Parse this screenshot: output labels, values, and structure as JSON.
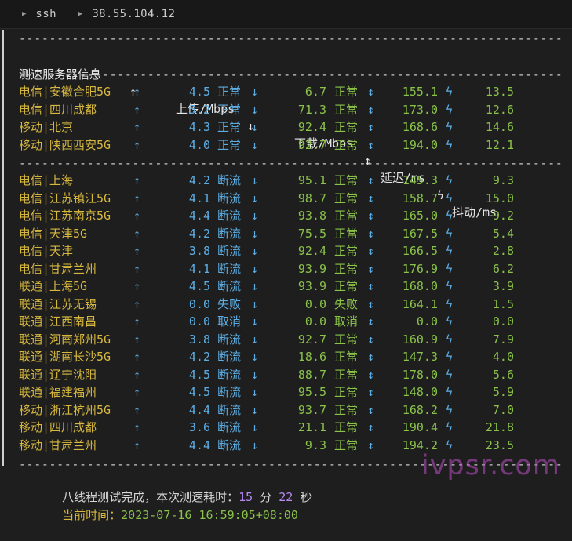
{
  "breadcrumb": {
    "items": [
      "ssh",
      "38.55.104.12"
    ]
  },
  "table": {
    "divider": "------------------------------------------------------------------------",
    "headers": [
      "测速服务器信息",
      "↑",
      "上传/Mbps",
      "↓",
      "下载/Mbps",
      "↕",
      "延迟/ms",
      "ϟ",
      "抖动/ms"
    ],
    "group1": [
      {
        "server": "电信|安徽合肥5G",
        "up": "4.5",
        "up_status": "正常",
        "down": "6.7",
        "down_status": "正常",
        "latency": "155.1",
        "jitter": "13.5"
      },
      {
        "server": "电信|四川成都",
        "up": "5.2",
        "up_status": "正常",
        "down": "71.3",
        "down_status": "正常",
        "latency": "173.0",
        "jitter": "12.6"
      },
      {
        "server": "移动|北京",
        "up": "4.3",
        "up_status": "正常",
        "down": "92.4",
        "down_status": "正常",
        "latency": "168.6",
        "jitter": "14.6"
      },
      {
        "server": "移动|陕西西安5G",
        "up": "4.0",
        "up_status": "正常",
        "down": "92.7",
        "down_status": "正常",
        "latency": "194.0",
        "jitter": "12.1"
      }
    ],
    "group2": [
      {
        "server": "电信|上海",
        "up": "4.2",
        "up_status": "断流",
        "down": "95.1",
        "down_status": "正常",
        "latency": "145.3",
        "jitter": "9.3"
      },
      {
        "server": "电信|江苏镇江5G",
        "up": "4.1",
        "up_status": "断流",
        "down": "98.7",
        "down_status": "正常",
        "latency": "158.7",
        "jitter": "15.0"
      },
      {
        "server": "电信|江苏南京5G",
        "up": "4.4",
        "up_status": "断流",
        "down": "93.8",
        "down_status": "正常",
        "latency": "165.0",
        "jitter": "9.2"
      },
      {
        "server": "电信|天津5G",
        "up": "4.2",
        "up_status": "断流",
        "down": "75.5",
        "down_status": "正常",
        "latency": "167.5",
        "jitter": "5.4"
      },
      {
        "server": "电信|天津",
        "up": "3.8",
        "up_status": "断流",
        "down": "92.4",
        "down_status": "正常",
        "latency": "166.5",
        "jitter": "2.8"
      },
      {
        "server": "电信|甘肃兰州",
        "up": "4.1",
        "up_status": "断流",
        "down": "93.9",
        "down_status": "正常",
        "latency": "176.9",
        "jitter": "6.2"
      },
      {
        "server": "联通|上海5G",
        "up": "4.5",
        "up_status": "断流",
        "down": "93.9",
        "down_status": "正常",
        "latency": "168.0",
        "jitter": "3.9"
      },
      {
        "server": "联通|江苏无锡",
        "up": "0.0",
        "up_status": "失败",
        "down": "0.0",
        "down_status": "失败",
        "latency": "164.1",
        "jitter": "1.5"
      },
      {
        "server": "联通|江西南昌",
        "up": "0.0",
        "up_status": "取消",
        "down": "0.0",
        "down_status": "取消",
        "latency": "0.0",
        "jitter": "0.0"
      },
      {
        "server": "联通|河南郑州5G",
        "up": "3.8",
        "up_status": "断流",
        "down": "92.7",
        "down_status": "正常",
        "latency": "160.9",
        "jitter": "7.9"
      },
      {
        "server": "联通|湖南长沙5G",
        "up": "4.2",
        "up_status": "断流",
        "down": "18.6",
        "down_status": "正常",
        "latency": "147.3",
        "jitter": "4.0"
      },
      {
        "server": "联通|辽宁沈阳",
        "up": "4.5",
        "up_status": "断流",
        "down": "88.7",
        "down_status": "正常",
        "latency": "178.0",
        "jitter": "5.6"
      },
      {
        "server": "联通|福建福州",
        "up": "4.5",
        "up_status": "断流",
        "down": "95.5",
        "down_status": "正常",
        "latency": "148.0",
        "jitter": "5.9"
      },
      {
        "server": "移动|浙江杭州5G",
        "up": "4.4",
        "up_status": "断流",
        "down": "93.7",
        "down_status": "正常",
        "latency": "168.2",
        "jitter": "7.0"
      },
      {
        "server": "移动|四川成都",
        "up": "3.6",
        "up_status": "断流",
        "down": "21.1",
        "down_status": "正常",
        "latency": "190.4",
        "jitter": "21.8"
      },
      {
        "server": "移动|甘肃兰州",
        "up": "4.4",
        "up_status": "断流",
        "down": "9.3",
        "down_status": "正常",
        "latency": "194.2",
        "jitter": "23.5"
      }
    ]
  },
  "footer": {
    "summary_prefix": "八线程测试完成，本次测速耗时：",
    "minutes": "15",
    "min_unit": "分",
    "seconds": "22",
    "sec_unit": "秒",
    "time_label": "当前时间：",
    "time_value": "2023-07-16 16:59:05+08:00"
  },
  "watermark": "ivpsr.com",
  "icons": {
    "breadcrumb_sep": "chevron-right-icon",
    "up": "arrow-up-icon",
    "down": "arrow-down-icon",
    "updown": "arrow-updown-icon",
    "jitter": "lightning-icon"
  },
  "colors": {
    "server": "#d7b83f",
    "upload": "#5dade2",
    "download": "#8ac24a",
    "latency_jitter": "#8ac24a",
    "numbers_accent": "#b989f5"
  }
}
